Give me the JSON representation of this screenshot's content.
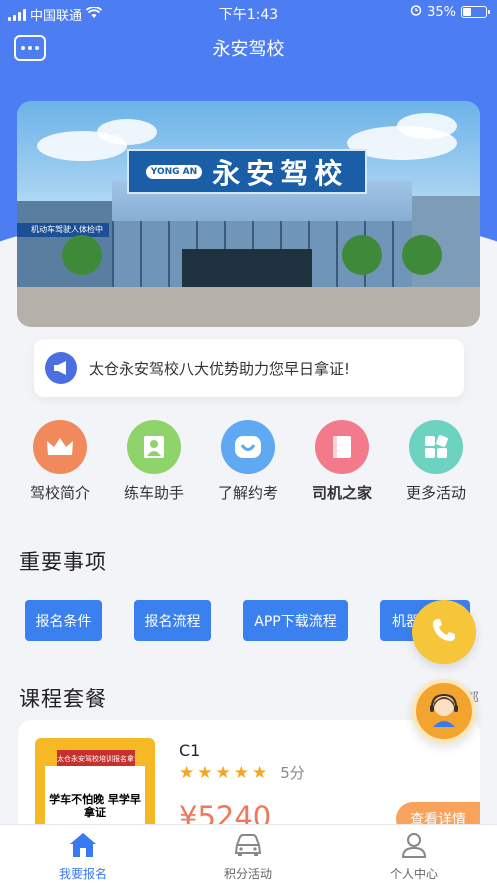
{
  "status_bar": {
    "carrier": "中国联通",
    "time": "下午1:43",
    "battery": "35%"
  },
  "nav": {
    "title": "永安驾校"
  },
  "banner": {
    "sign_text": "永安驾校",
    "logo_text": "YONG AN",
    "side_sign": "机动车驾驶人体检中"
  },
  "notice": {
    "text": "太仓永安驾校八大优势助力您早日拿证!"
  },
  "quick_menu": [
    {
      "label": "驾校简介",
      "color": "#f08a5d"
    },
    {
      "label": "练车助手",
      "color": "#8fd46b"
    },
    {
      "label": "了解约考",
      "color": "#5fa8f2"
    },
    {
      "label": "司机之家",
      "color": "#f27a8a"
    },
    {
      "label": "更多活动",
      "color": "#6dd2c0"
    }
  ],
  "sections": {
    "important": "重要事项",
    "courses": "课程套餐"
  },
  "tags": [
    "报名条件",
    "报名流程",
    "APP下载流程",
    "机器"
  ],
  "more_label": "全部",
  "course": {
    "name": "C1",
    "rating": 5,
    "score": "5分",
    "price": "¥5240",
    "detail_label": "查看详情",
    "img_top": "太仓永安驾校培训报名拿证",
    "img_slogan": "学车不怕晚 早学早拿证"
  },
  "tabbar": [
    {
      "label": "我要报名",
      "icon": "home-icon",
      "active": true
    },
    {
      "label": "积分活动",
      "icon": "car-icon",
      "active": false
    },
    {
      "label": "个人中心",
      "icon": "user-icon",
      "active": false
    }
  ]
}
